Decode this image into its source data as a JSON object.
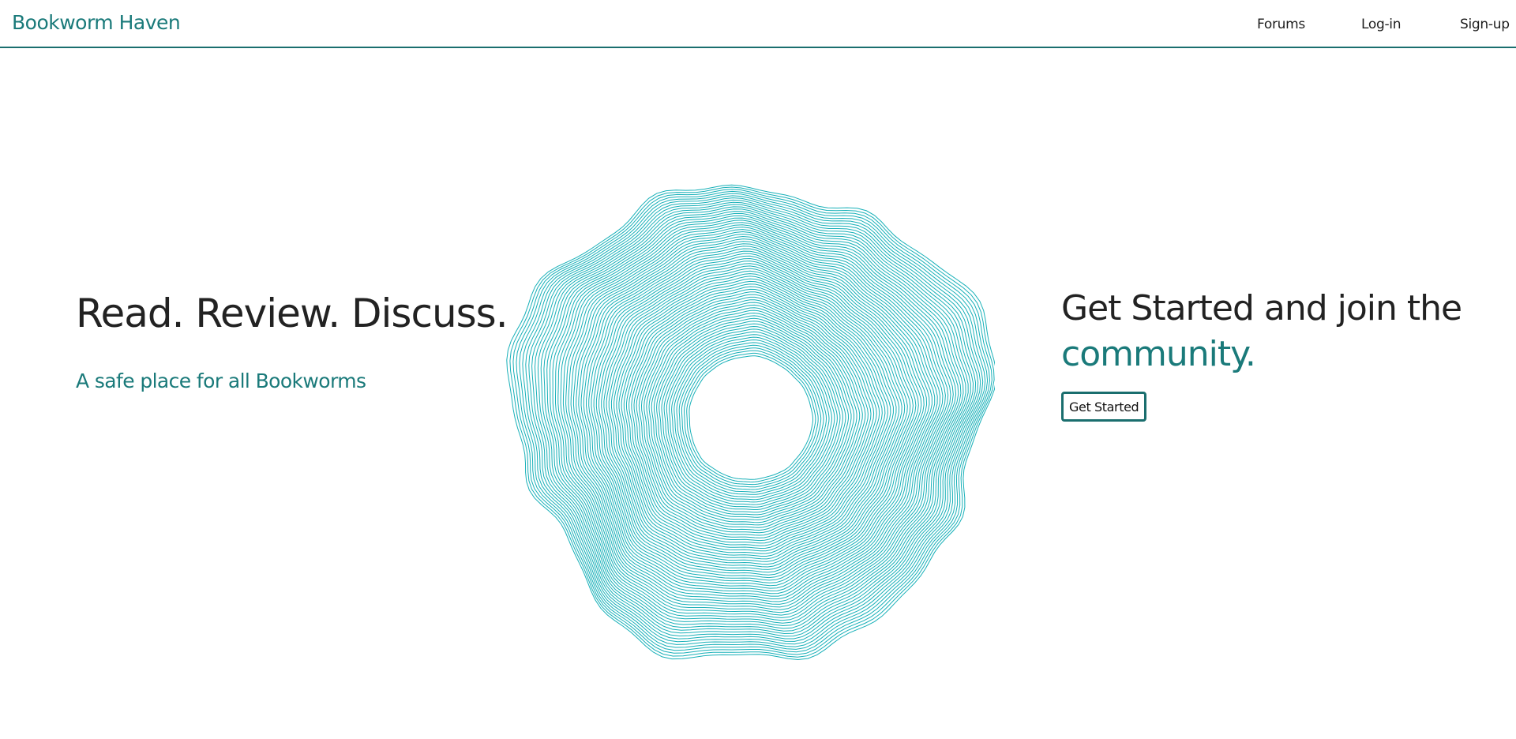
{
  "brand": {
    "name": "Bookworm Haven",
    "color": "#1a7a7a"
  },
  "nav": {
    "items": [
      {
        "label": "Forums"
      },
      {
        "label": "Log-in"
      },
      {
        "label": "Sign-up"
      }
    ],
    "border_color": "#1a6e6e"
  },
  "hero": {
    "title": "Read. Review. Discuss.",
    "subtitle": "A safe place for all Bookworms"
  },
  "graphic": {
    "icon": "topographic-swirl-ring",
    "stroke_color": "#17b0b8"
  },
  "cta": {
    "heading_part1": "Get Started and join the",
    "heading_part2": "community.",
    "button_label": "Get Started",
    "accent_color": "#1a7a7a"
  }
}
